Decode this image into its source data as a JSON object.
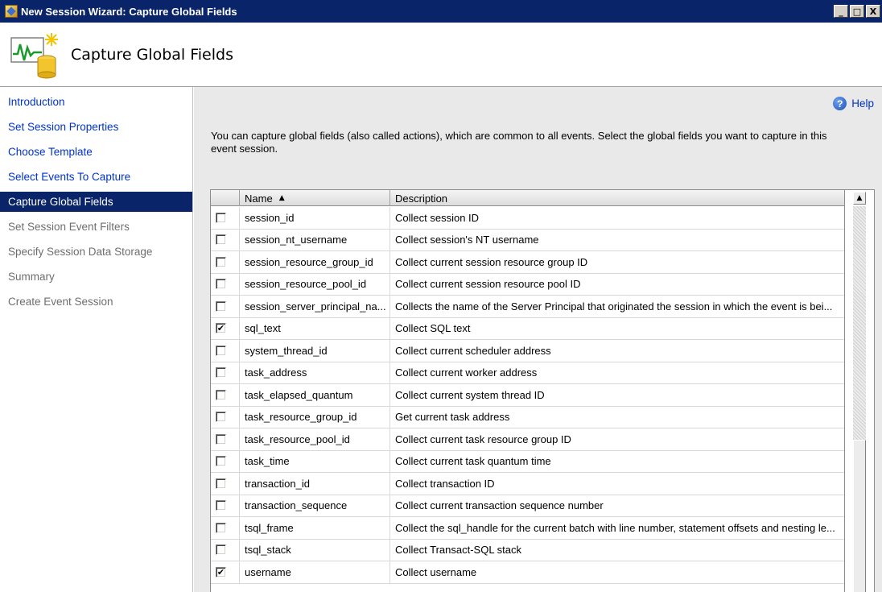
{
  "window": {
    "title": "New Session Wizard: Capture Global Fields",
    "minimize": "_",
    "maximize": "□",
    "close": "X"
  },
  "header": {
    "title": "Capture Global Fields"
  },
  "nav": {
    "items": [
      {
        "label": "Introduction",
        "state": "link"
      },
      {
        "label": "Set Session Properties",
        "state": "link"
      },
      {
        "label": "Choose Template",
        "state": "link"
      },
      {
        "label": "Select Events To Capture",
        "state": "link"
      },
      {
        "label": "Capture Global Fields",
        "state": "active"
      },
      {
        "label": "Set Session Event Filters",
        "state": "disabled"
      },
      {
        "label": "Specify Session Data Storage",
        "state": "disabled"
      },
      {
        "label": "Summary",
        "state": "disabled"
      },
      {
        "label": "Create Event Session",
        "state": "disabled"
      }
    ]
  },
  "help": {
    "icon": "?",
    "label": "Help"
  },
  "intro": {
    "text": "You can capture global fields (also called actions), which are common to all events. Select the global fields you want to capture in this event session."
  },
  "grid": {
    "columns": {
      "name": "Name",
      "sort_indicator": "▲",
      "description": "Description"
    },
    "rows": [
      {
        "checked": false,
        "name": "session_id",
        "description": "Collect session ID"
      },
      {
        "checked": false,
        "name": "session_nt_username",
        "description": "Collect session's NT username"
      },
      {
        "checked": false,
        "name": "session_resource_group_id",
        "description": "Collect current session resource group ID"
      },
      {
        "checked": false,
        "name": "session_resource_pool_id",
        "description": "Collect current session resource pool ID"
      },
      {
        "checked": false,
        "name": "session_server_principal_na...",
        "description": "Collects the name of the Server Principal that originated the session in which the event is bei..."
      },
      {
        "checked": true,
        "name": "sql_text",
        "description": "Collect SQL text"
      },
      {
        "checked": false,
        "name": "system_thread_id",
        "description": "Collect current scheduler address"
      },
      {
        "checked": false,
        "name": "task_address",
        "description": "Collect current worker address"
      },
      {
        "checked": false,
        "name": "task_elapsed_quantum",
        "description": "Collect current system thread ID"
      },
      {
        "checked": false,
        "name": "task_resource_group_id",
        "description": "Get current task address"
      },
      {
        "checked": false,
        "name": "task_resource_pool_id",
        "description": "Collect current task resource group ID"
      },
      {
        "checked": false,
        "name": "task_time",
        "description": "Collect current task quantum time"
      },
      {
        "checked": false,
        "name": "transaction_id",
        "description": "Collect transaction ID"
      },
      {
        "checked": false,
        "name": "transaction_sequence",
        "description": "Collect current transaction sequence number"
      },
      {
        "checked": false,
        "name": "tsql_frame",
        "description": "Collect the sql_handle for the current batch with line number, statement offsets and nesting le..."
      },
      {
        "checked": false,
        "name": "tsql_stack",
        "description": "Collect Transact-SQL stack"
      },
      {
        "checked": true,
        "name": "username",
        "description": "Collect username"
      }
    ],
    "check_mark": "✔"
  },
  "scrollbar": {
    "up_arrow": "▲"
  }
}
